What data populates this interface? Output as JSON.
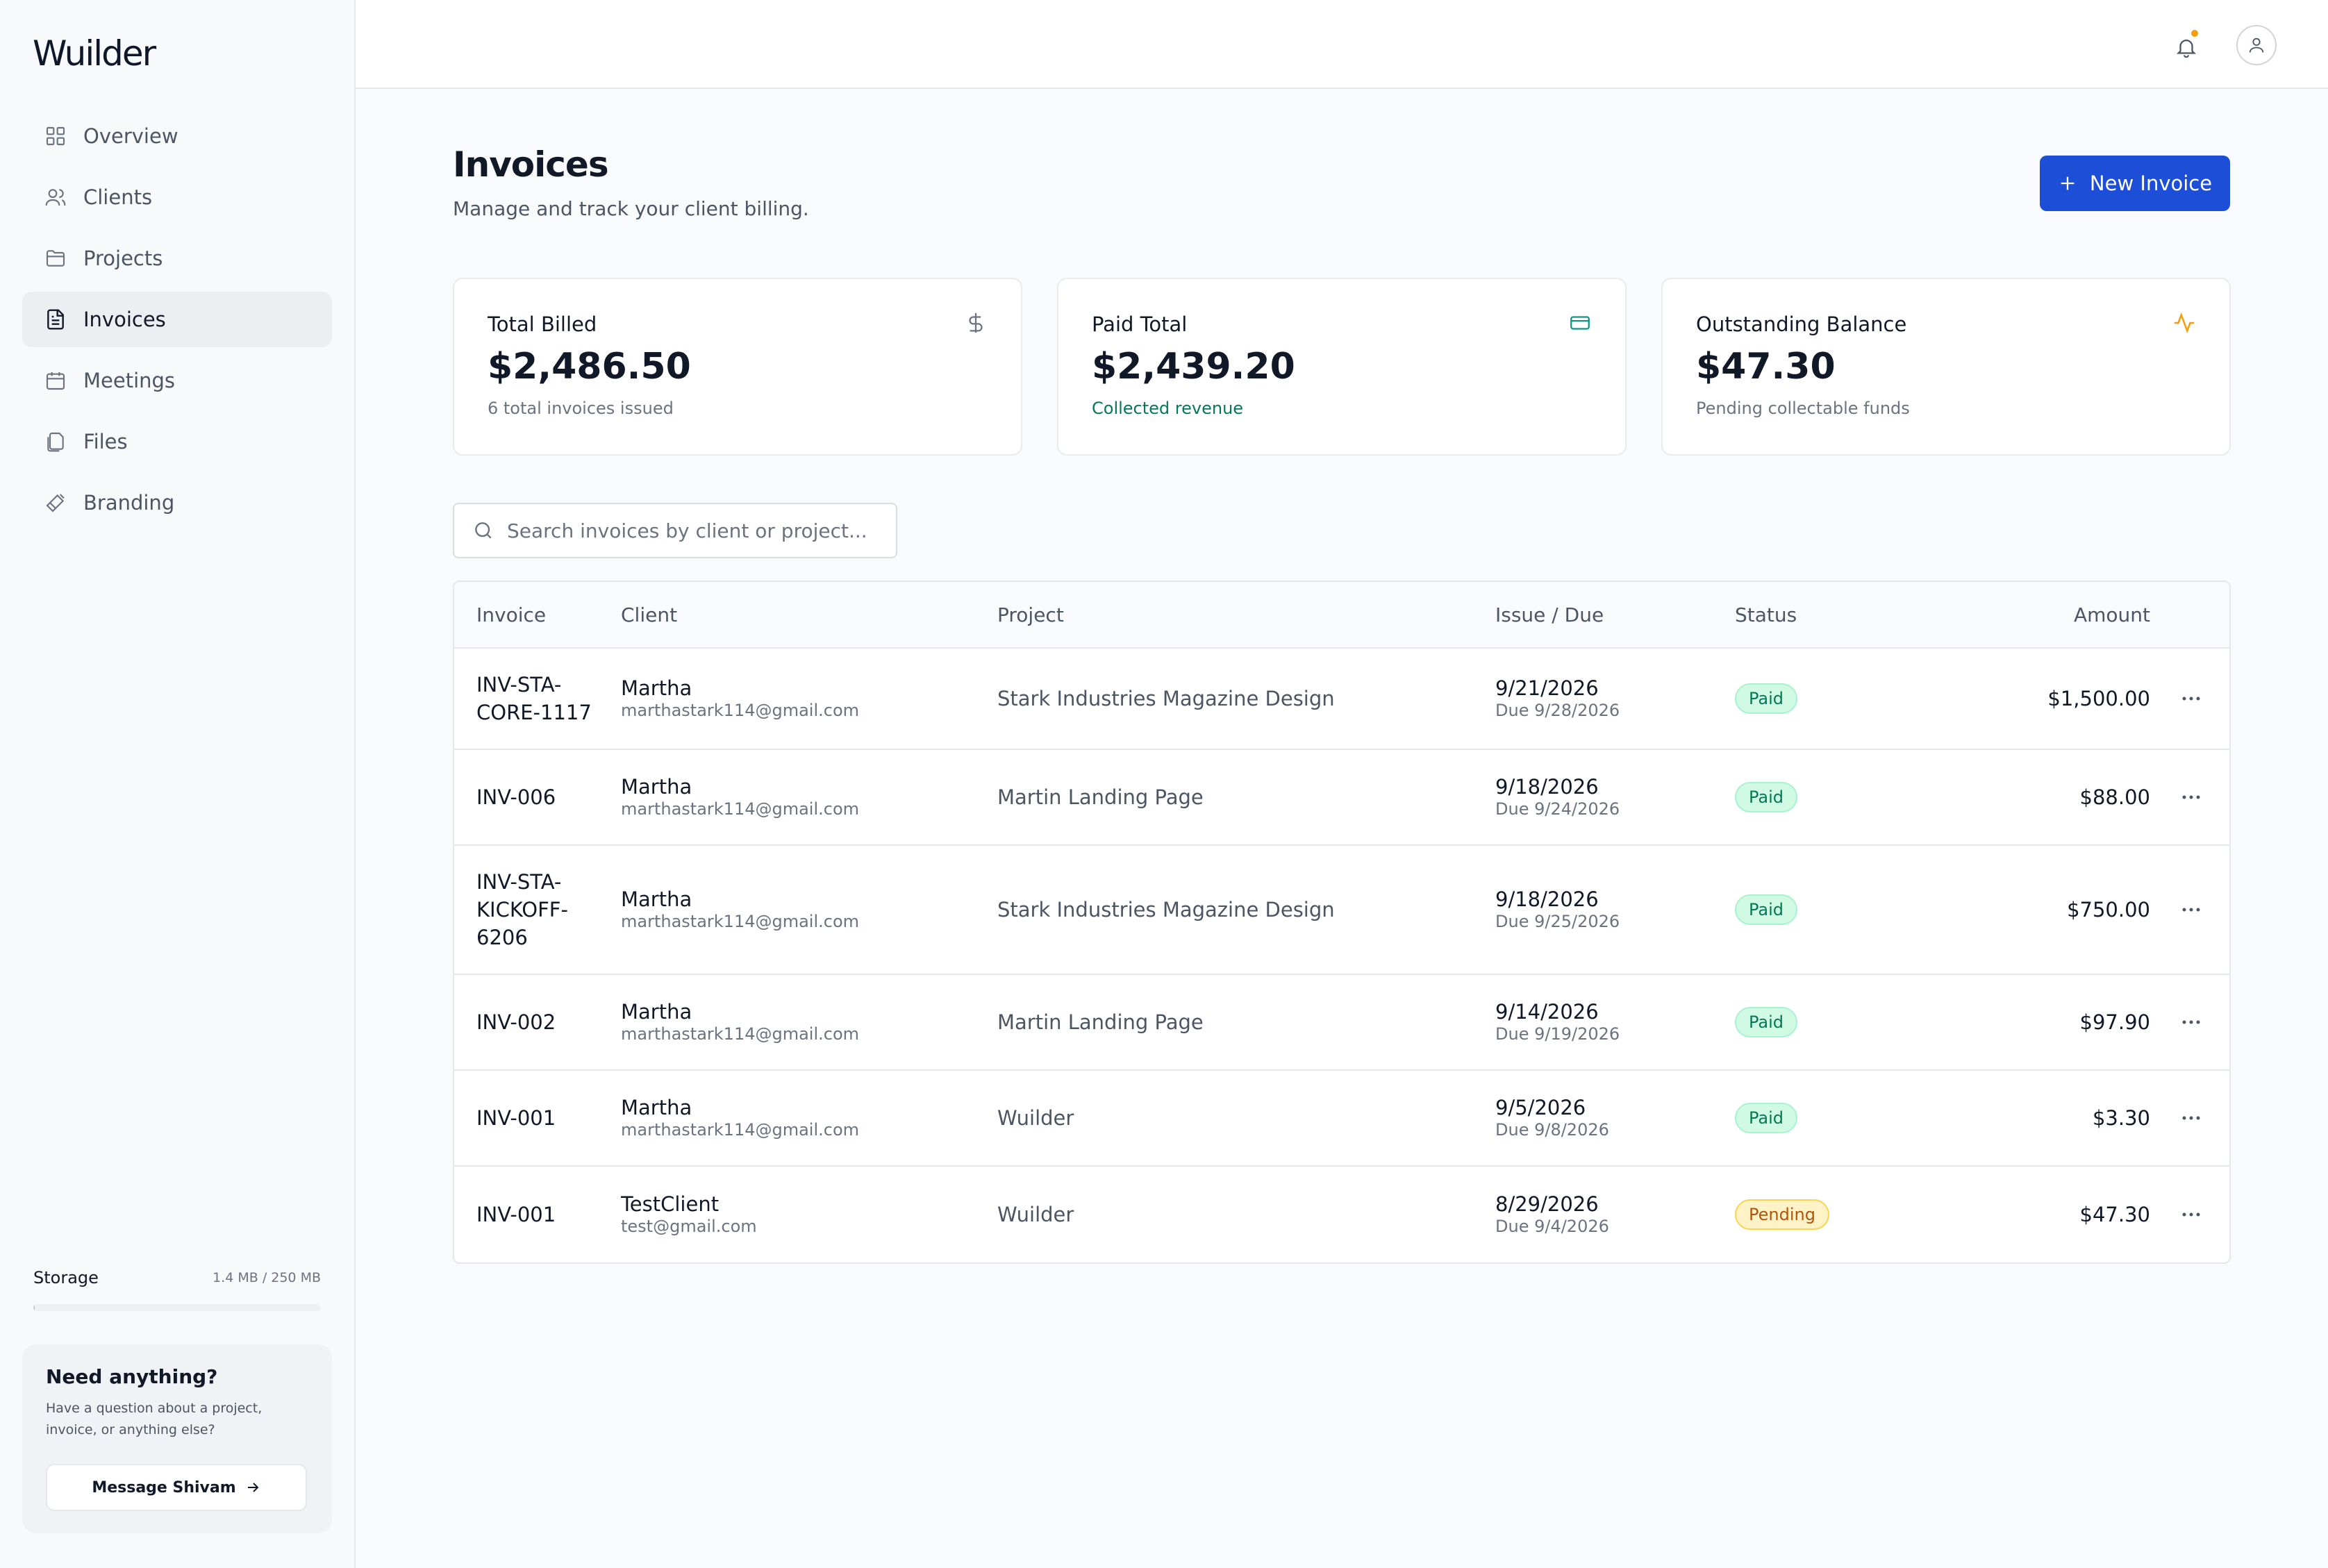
{
  "app": {
    "name": "Wuilder"
  },
  "sidebar": {
    "items": [
      {
        "label": "Overview",
        "icon": "grid-icon"
      },
      {
        "label": "Clients",
        "icon": "users-icon"
      },
      {
        "label": "Projects",
        "icon": "folder-icon"
      },
      {
        "label": "Invoices",
        "icon": "file-text-icon",
        "active": true
      },
      {
        "label": "Meetings",
        "icon": "calendar-icon"
      },
      {
        "label": "Files",
        "icon": "files-icon"
      },
      {
        "label": "Branding",
        "icon": "brush-icon"
      }
    ],
    "storage": {
      "label": "Storage",
      "value": "1.4 MB / 250 MB",
      "used_fraction": 0.0056
    },
    "help": {
      "title": "Need anything?",
      "text": "Have a question about a project, invoice, or anything else?",
      "button_label": "Message Shivam"
    }
  },
  "topbar": {
    "notification_dot": true
  },
  "page": {
    "title": "Invoices",
    "subtitle": "Manage and track your client billing.",
    "new_button_label": "New Invoice"
  },
  "stats": [
    {
      "label": "Total Billed",
      "value": "$2,486.50",
      "sub": "6 total invoices issued",
      "icon": "dollar-icon"
    },
    {
      "label": "Paid Total",
      "value": "$2,439.20",
      "sub": "Collected revenue",
      "icon": "credit-card-icon"
    },
    {
      "label": "Outstanding Balance",
      "value": "$47.30",
      "sub": "Pending collectable funds",
      "icon": "activity-icon"
    }
  ],
  "search": {
    "placeholder": "Search invoices by client or project...",
    "value": ""
  },
  "table": {
    "headers": [
      "Invoice",
      "Client",
      "Project",
      "Issue / Due",
      "Status",
      "Amount"
    ],
    "rows": [
      {
        "invoice": "INV-STA-CORE-1117",
        "client": "Martha",
        "email": "marthastark114@gmail.com",
        "project": "Stark Industries Magazine Design",
        "issue": "9/21/2026",
        "due": "Due 9/28/2026",
        "status": "Paid",
        "amount": "$1,500.00"
      },
      {
        "invoice": "INV-006",
        "client": "Martha",
        "email": "marthastark114@gmail.com",
        "project": "Martin Landing Page",
        "issue": "9/18/2026",
        "due": "Due 9/24/2026",
        "status": "Paid",
        "amount": "$88.00"
      },
      {
        "invoice": "INV-STA-KICKOFF-6206",
        "client": "Martha",
        "email": "marthastark114@gmail.com",
        "project": "Stark Industries Magazine Design",
        "issue": "9/18/2026",
        "due": "Due 9/25/2026",
        "status": "Paid",
        "amount": "$750.00"
      },
      {
        "invoice": "INV-002",
        "client": "Martha",
        "email": "marthastark114@gmail.com",
        "project": "Martin Landing Page",
        "issue": "9/14/2026",
        "due": "Due 9/19/2026",
        "status": "Paid",
        "amount": "$97.90"
      },
      {
        "invoice": "INV-001",
        "client": "Martha",
        "email": "marthastark114@gmail.com",
        "project": "Wuilder",
        "issue": "9/5/2026",
        "due": "Due 9/8/2026",
        "status": "Paid",
        "amount": "$3.30"
      },
      {
        "invoice": "INV-001",
        "client": "TestClient",
        "email": "test@gmail.com",
        "project": "Wuilder",
        "issue": "8/29/2026",
        "due": "Due 9/4/2026",
        "status": "Pending",
        "amount": "$47.30"
      }
    ]
  },
  "colors": {
    "accent": "#1d4ed8",
    "paid": "#047857",
    "pending": "#b45309",
    "activity": "#f59e0b",
    "card": "#0d9488"
  }
}
